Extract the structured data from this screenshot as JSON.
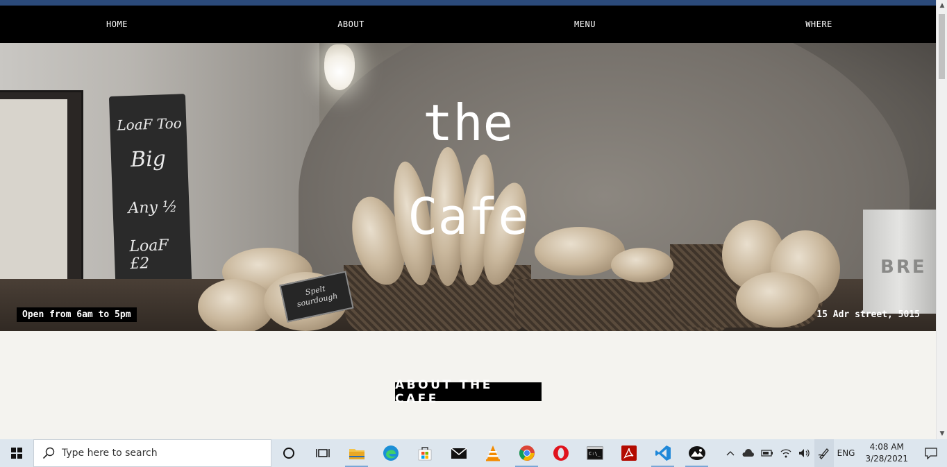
{
  "nav": {
    "items": [
      "HOME",
      "ABOUT",
      "MENU",
      "WHERE"
    ]
  },
  "hero": {
    "title_line1": "the",
    "title_line2": "Cafe",
    "hours": "Open from 6am to 5pm",
    "address": "15 Adr street, 5015",
    "chalkboard": [
      "LoaF Too",
      "Big",
      "Any ½",
      "LoaF £2"
    ],
    "sign": [
      "Spelt",
      "sourdough"
    ],
    "tin_text": "BRE"
  },
  "about": {
    "title": "ABOUT THE CAFE"
  },
  "taskbar": {
    "search_placeholder": "Type here to search",
    "apps": [
      "cortana-icon",
      "task-view-icon",
      "file-explorer-icon",
      "edge-icon",
      "store-icon",
      "mail-icon",
      "vlc-icon",
      "chrome-icon",
      "opera-icon",
      "terminal-icon",
      "acrobat-icon",
      "vscode-icon",
      "photos-icon"
    ],
    "language": "ENG",
    "time": "4:08 AM",
    "date": "3/28/2021"
  },
  "colors": {
    "accent_bar": "#2b4a7a",
    "nav_bg": "#000000",
    "page_bg": "#f4f3ef",
    "taskbar_bg": "#dde6ee"
  }
}
